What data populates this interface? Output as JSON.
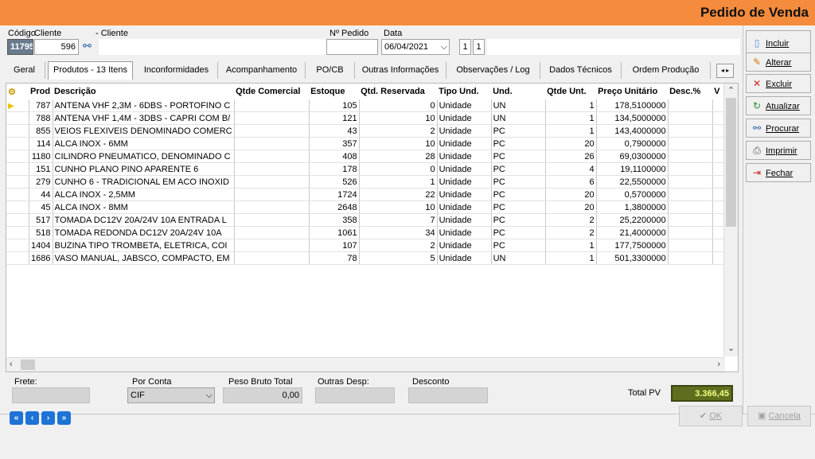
{
  "window": {
    "title": "Pedido de Venda"
  },
  "header": {
    "codigo_label": "Código",
    "codigo_value": "11795",
    "cliente_label": "Cliente",
    "cliente_name_label": "- Cliente",
    "cliente_value": "596",
    "npedido_label": "Nº Pedido",
    "npedido_value": "",
    "data_label": "Data",
    "data_value": "06/04/2021",
    "num1": "1",
    "num2": "1"
  },
  "tabs": [
    {
      "label": "Geral"
    },
    {
      "label": "Produtos - 13 Itens"
    },
    {
      "label": "Inconformidades"
    },
    {
      "label": "Acompanhamento"
    },
    {
      "label": "PO/CB"
    },
    {
      "label": "Outras Informações"
    },
    {
      "label": "Observações / Log"
    },
    {
      "label": "Dados Técnicos"
    },
    {
      "label": "Ordem Produção"
    }
  ],
  "grid": {
    "columns": [
      "Prod",
      "Descrição",
      "Qtde Comercial",
      "Estoque",
      "Qtd. Reservada",
      "Tipo Und.",
      "Und.",
      "Qtde Unt.",
      "Preço Unitário",
      "Desc.%",
      "V"
    ],
    "rows": [
      [
        "787",
        "ANTENA VHF 2,3M - 6DBS - PORTOFINO C",
        "",
        "105",
        "0",
        "Unidade",
        "UN",
        "1",
        "178,5100000",
        "",
        ""
      ],
      [
        "788",
        "ANTENA VHF 1,4M - 3DBS - CAPRI COM B/",
        "",
        "121",
        "10",
        "Unidade",
        "UN",
        "1",
        "134,5000000",
        "",
        ""
      ],
      [
        "855",
        "VEIOS FLEXIVEIS DENOMINADO COMERC",
        "",
        "43",
        "2",
        "Unidade",
        "PC",
        "1",
        "143,4000000",
        "",
        ""
      ],
      [
        "114",
        "ALCA INOX - 6MM",
        "",
        "357",
        "10",
        "Unidade",
        "PC",
        "20",
        "0,7900000",
        "",
        ""
      ],
      [
        "1180",
        "CILINDRO PNEUMATICO, DENOMINADO C",
        "",
        "408",
        "28",
        "Unidade",
        "PC",
        "26",
        "69,0300000",
        "",
        ""
      ],
      [
        "151",
        "CUNHO PLANO PINO APARENTE 6",
        "",
        "178",
        "0",
        "Unidade",
        "PC",
        "4",
        "19,1100000",
        "",
        ""
      ],
      [
        "279",
        "CUNHO 6  - TRADICIONAL EM ACO INOXID",
        "",
        "526",
        "1",
        "Unidade",
        "PC",
        "6",
        "22,5500000",
        "",
        ""
      ],
      [
        "44",
        "ALCA INOX - 2,5MM",
        "",
        "1724",
        "22",
        "Unidade",
        "PC",
        "20",
        "0,5700000",
        "",
        ""
      ],
      [
        "45",
        "ALCA INOX - 8MM",
        "",
        "2648",
        "10",
        "Unidade",
        "PC",
        "20",
        "1,3800000",
        "",
        ""
      ],
      [
        "517",
        "TOMADA DC12V 20A/24V 10A ENTRADA L",
        "",
        "358",
        "7",
        "Unidade",
        "PC",
        "2",
        "25,2200000",
        "",
        ""
      ],
      [
        "518",
        "TOMADA REDONDA DC12V 20A/24V 10A",
        "",
        "1061",
        "34",
        "Unidade",
        "PC",
        "2",
        "21,4000000",
        "",
        ""
      ],
      [
        "1404",
        "BUZINA TIPO TROMBETA, ELETRICA, COI",
        "",
        "107",
        "2",
        "Unidade",
        "PC",
        "1",
        "177,7500000",
        "",
        ""
      ],
      [
        "1686",
        "VASO MANUAL, JABSCO, COMPACTO, EM",
        "",
        "78",
        "5",
        "Unidade",
        "UN",
        "1",
        "501,3300000",
        "",
        ""
      ]
    ]
  },
  "footer": {
    "frete_label": "Frete:",
    "frete_value": "",
    "porconta_label": "Por Conta",
    "porconta_value": "CIF",
    "peso_label": "Peso Bruto Total",
    "peso_value": "0,00",
    "outras_label": "Outras Desp:",
    "outras_value": "",
    "desconto_label": "Desconto",
    "desconto_value": "",
    "total_label": "Total PV",
    "total_value": "3.366,45"
  },
  "side_buttons": [
    {
      "label": "Incluir",
      "icon": "document-icon"
    },
    {
      "label": "Alterar",
      "icon": "pencil-icon"
    },
    {
      "label": "Excluir",
      "icon": "x-icon"
    },
    {
      "label": "Atualizar",
      "icon": "refresh-icon"
    },
    {
      "label": "Procurar",
      "icon": "binoculars-icon"
    },
    {
      "label": "Imprimir",
      "icon": "printer-icon"
    },
    {
      "label": "Fechar",
      "icon": "exit-icon"
    }
  ],
  "bottom": {
    "ok_label": "OK",
    "cancel_label": "Cancela"
  },
  "colors": {
    "title_bar": "#f58b3c",
    "nav": "#1e73d6",
    "total_bg": "#5e6e1e",
    "total_fg": "#f0ff80"
  }
}
